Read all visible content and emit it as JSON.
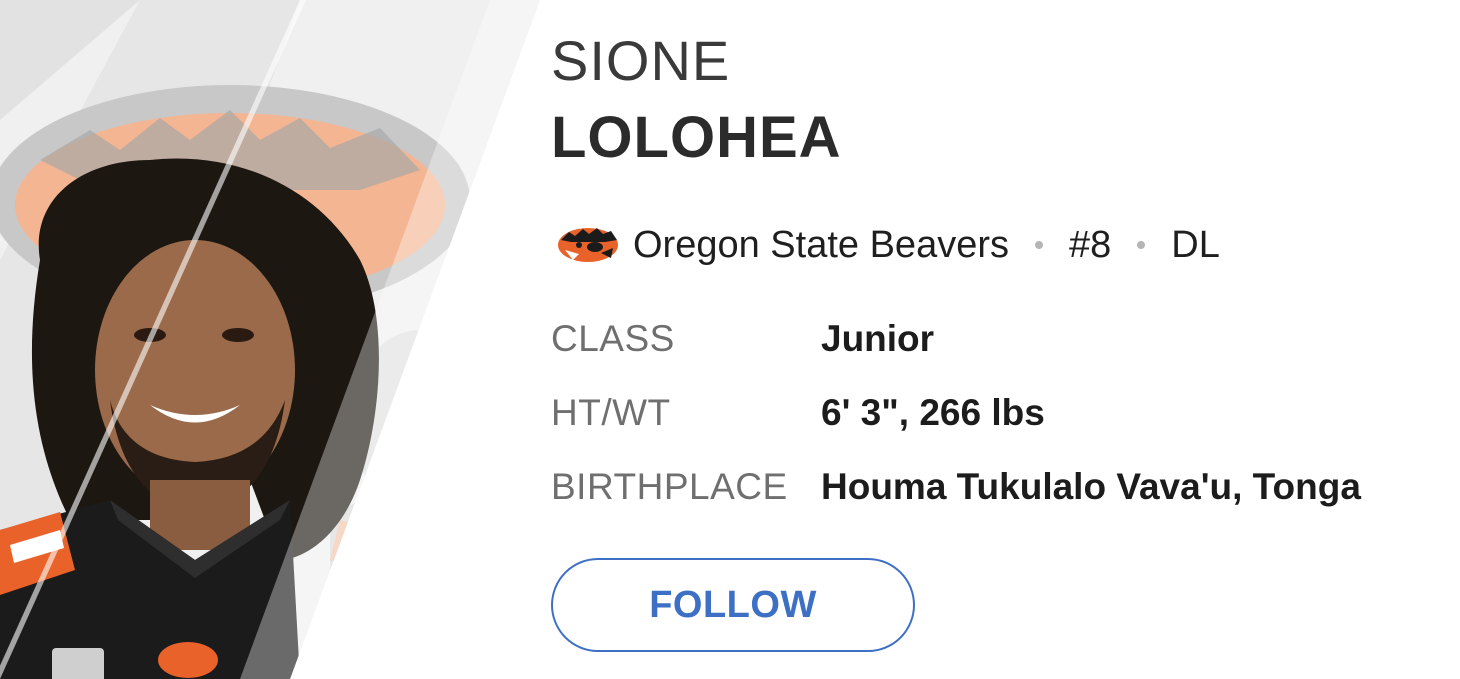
{
  "player": {
    "first_name": "SIONE",
    "last_name": "LOLOHEA"
  },
  "team": {
    "logo_icon": "oregon-state-beaver-logo-icon",
    "name": "Oregon State Beavers",
    "number": "#8",
    "position": "DL"
  },
  "stats": [
    {
      "label": "CLASS",
      "value": "Junior"
    },
    {
      "label": "HT/WT",
      "value": "6' 3\", 266 lbs"
    },
    {
      "label": "BIRTHPLACE",
      "value": "Houma Tukulalo Vava'u, Tonga"
    }
  ],
  "follow_button": {
    "label": "FOLLOW"
  },
  "colors": {
    "accent": "#3d6fc4",
    "team_orange": "#e8622a",
    "team_black": "#1b1b1b"
  }
}
